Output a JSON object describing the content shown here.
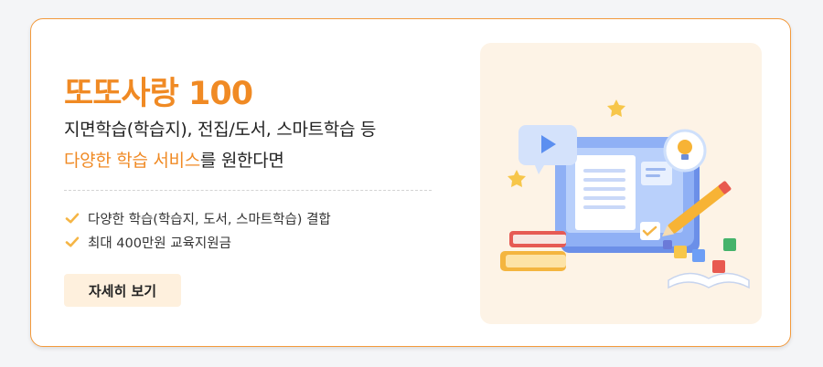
{
  "banner": {
    "title": "또또사랑 100",
    "description_line1": "지면학습(학습지), 전집/도서, 스마트학습 등",
    "description_line2_highlight": "다양한 학습 서비스",
    "description_line2_rest": "를 원한다면",
    "features": [
      {
        "text": "다양한 학습(학습지, 도서, 스마트학습) 결합",
        "icon": "checkmark-icon"
      },
      {
        "text": "최대 400만원 교육지원금",
        "icon": "checkmark-icon"
      }
    ],
    "button_label": "자세히 보기"
  },
  "colors": {
    "accent": "#f08a24",
    "card_border": "#f39a3c",
    "button_bg": "#fef0dd",
    "illustration_bg": "#fdf3e6"
  }
}
